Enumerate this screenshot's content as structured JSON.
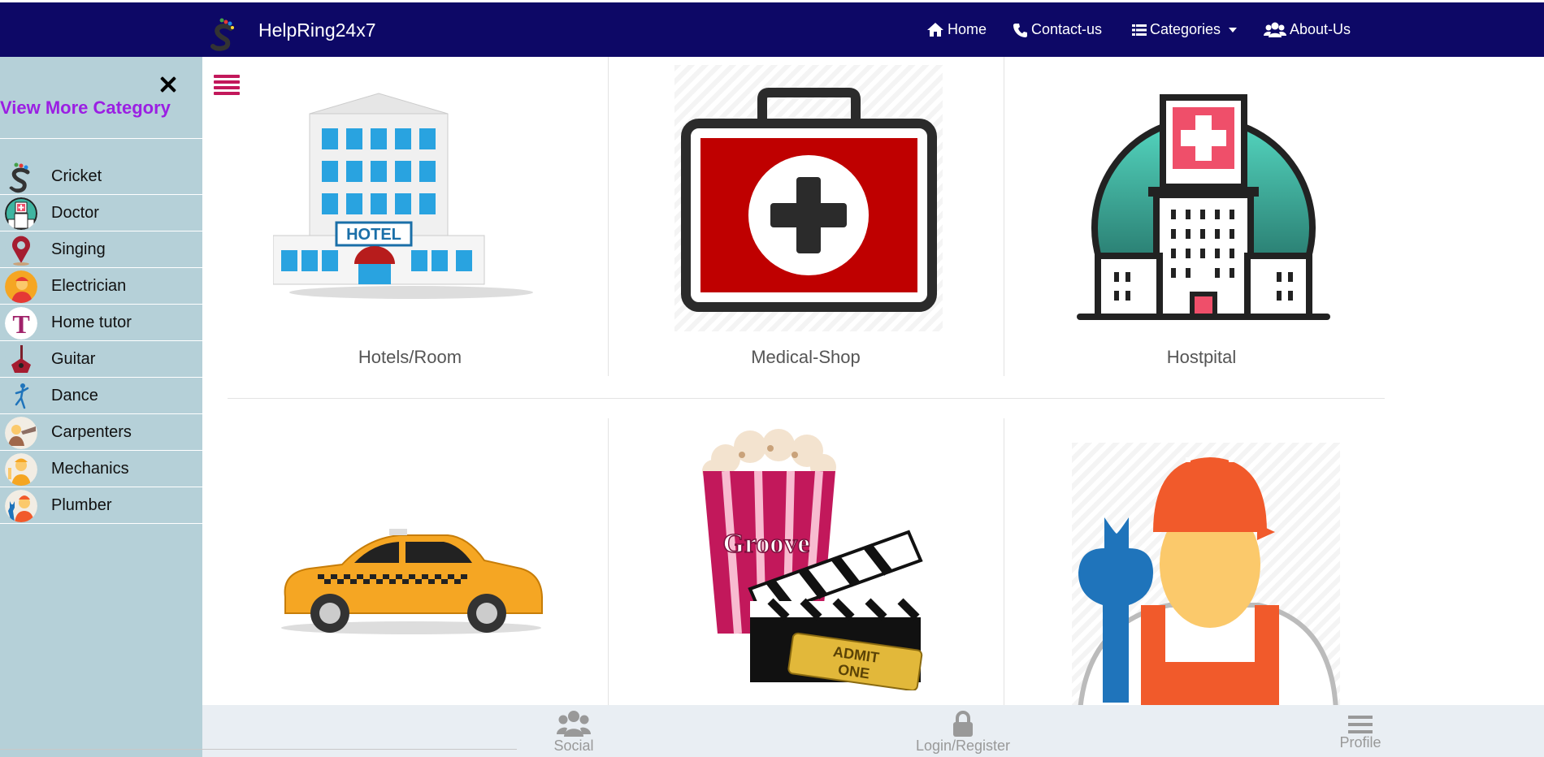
{
  "header": {
    "brand": "HelpRing24x7",
    "nav": {
      "home": "Home",
      "contact": "Contact-us",
      "categories": "Categories",
      "about": "About-Us"
    }
  },
  "sidebar": {
    "view_more": "View More Category",
    "items": [
      {
        "label": "Cricket",
        "icon": "cricket-icon"
      },
      {
        "label": "Doctor",
        "icon": "doctor-icon"
      },
      {
        "label": "Singing",
        "icon": "singing-icon"
      },
      {
        "label": "Electrician",
        "icon": "electrician-icon"
      },
      {
        "label": "Home tutor",
        "icon": "home-tutor-icon"
      },
      {
        "label": "Guitar",
        "icon": "guitar-icon"
      },
      {
        "label": "Dance",
        "icon": "dance-icon"
      },
      {
        "label": "Carpenters",
        "icon": "carpenters-icon"
      },
      {
        "label": "Mechanics",
        "icon": "mechanics-icon"
      },
      {
        "label": "Plumber",
        "icon": "plumber-icon"
      }
    ]
  },
  "categories": [
    {
      "label": "Hotels/Room",
      "icon": "hotel-icon"
    },
    {
      "label": "Medical-Shop",
      "icon": "medical-kit-icon"
    },
    {
      "label": "Hostpital",
      "icon": "hospital-icon"
    },
    {
      "label": "",
      "icon": "taxi-icon"
    },
    {
      "label": "",
      "icon": "cinema-icon"
    },
    {
      "label": "",
      "icon": "repairman-icon"
    }
  ],
  "bottom_bar": {
    "social": "Social",
    "login": "Login/Register",
    "profile": "Profile"
  }
}
